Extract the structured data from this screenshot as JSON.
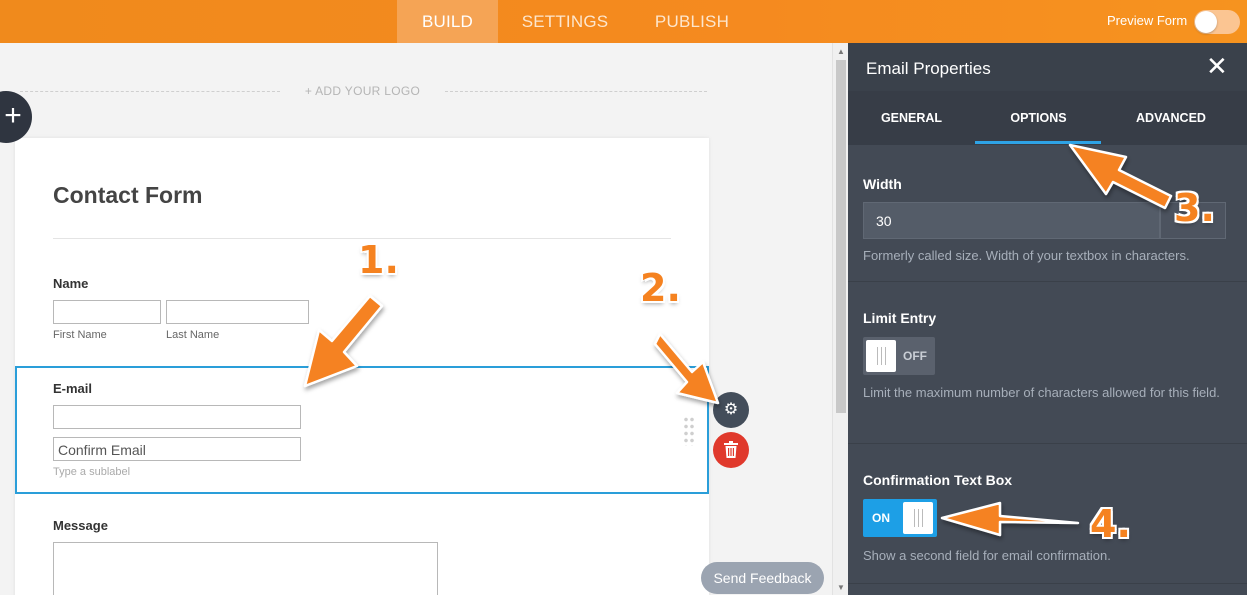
{
  "topbar": {
    "tabs": [
      {
        "label": "BUILD",
        "active": true
      },
      {
        "label": "SETTINGS",
        "active": false
      },
      {
        "label": "PUBLISH",
        "active": false
      }
    ],
    "preview_label": "Preview Form",
    "preview_enabled": false
  },
  "canvas": {
    "add_logo_label": "+ ADD YOUR LOGO",
    "add_button_icon": "plus-icon"
  },
  "form": {
    "title": "Contact Form",
    "name_field": {
      "label": "Name",
      "first_sublabel": "First Name",
      "last_sublabel": "Last Name"
    },
    "email_field": {
      "label": "E-mail",
      "value": "",
      "confirm_value": "Confirm Email",
      "sublabel_placeholder": "Type a sublabel"
    },
    "message_field": {
      "label": "Message"
    }
  },
  "feedback_button": "Send Feedback",
  "panel": {
    "title": "Email Properties",
    "tabs": [
      {
        "label": "GENERAL",
        "active": false
      },
      {
        "label": "OPTIONS",
        "active": true
      },
      {
        "label": "ADVANCED",
        "active": false
      }
    ],
    "width": {
      "label": "Width",
      "value": "30",
      "description": "Formerly called size. Width of your textbox in characters."
    },
    "limit_entry": {
      "label": "Limit Entry",
      "state": "OFF",
      "description": "Limit the maximum number of characters allowed for this field."
    },
    "confirmation": {
      "label": "Confirmation Text Box",
      "state": "ON",
      "description": "Show a second field for email confirmation."
    }
  },
  "annotations": [
    "1.",
    "2.",
    "3.",
    "4."
  ],
  "colors": {
    "topbar": "#f58a1f",
    "panel_bg": "#434a55",
    "accent_blue": "#2ea3e6",
    "annotation_orange": "#f58220",
    "delete_red": "#e0392c"
  }
}
